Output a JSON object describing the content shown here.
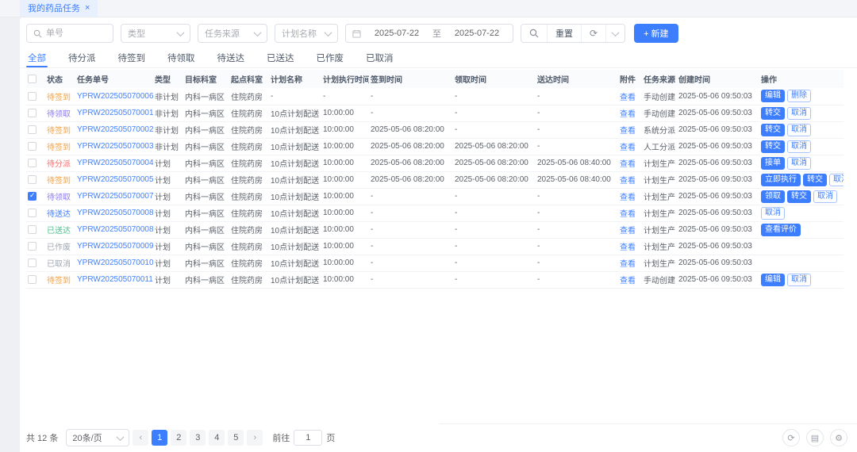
{
  "colors": {
    "primary": "#3D7EFF",
    "link": "#4080FF",
    "status": {
      "orange": "#F2A143",
      "purple": "#8A7BF0",
      "red": "#F56E6E",
      "blue": "#4080FF",
      "green": "#4FC08D",
      "gray": "#A1A7B0"
    }
  },
  "icons": {
    "close": "×",
    "refresh": "⟳",
    "grid": "▤",
    "gear": "⚙",
    "prev": "‹",
    "next": "›"
  },
  "tabbar": {
    "title": "我的药品任务"
  },
  "filters": {
    "order_placeholder": "单号",
    "type_placeholder": "类型",
    "source_placeholder": "任务来源",
    "plan_placeholder": "计划名称",
    "date_start": "2025-07-22",
    "date_to_label": "至",
    "date_end": "2025-07-22",
    "reset_label": "重置",
    "create_label": "+ 新建"
  },
  "status_tabs": [
    {
      "id": "all",
      "label": "全部",
      "active": true
    },
    {
      "id": "to-dispatch",
      "label": "待分派",
      "active": false
    },
    {
      "id": "to-signin",
      "label": "待签到",
      "active": false
    },
    {
      "id": "to-pickup",
      "label": "待领取",
      "active": false
    },
    {
      "id": "to-deliver",
      "label": "待送达",
      "active": false
    },
    {
      "id": "delivered",
      "label": "已送达",
      "active": false
    },
    {
      "id": "voided",
      "label": "已作废",
      "active": false
    },
    {
      "id": "cancelled",
      "label": "已取消",
      "active": false
    }
  ],
  "table": {
    "columns": [
      {
        "key": "status",
        "label": "状态"
      },
      {
        "key": "task-no",
        "label": "任务单号"
      },
      {
        "key": "type",
        "label": "类型"
      },
      {
        "key": "target-dept",
        "label": "目标科室"
      },
      {
        "key": "start-dept",
        "label": "起点科室"
      },
      {
        "key": "plan-name",
        "label": "计划名称"
      },
      {
        "key": "plan-exec-time",
        "label": "计划执行时间"
      },
      {
        "key": "signin-time",
        "label": "签到时间"
      },
      {
        "key": "pickup-time",
        "label": "领取时间"
      },
      {
        "key": "delivery-time",
        "label": "送达时间"
      },
      {
        "key": "attachment",
        "label": "附件"
      },
      {
        "key": "task-source",
        "label": "任务来源"
      },
      {
        "key": "created-time",
        "label": "创建时间"
      },
      {
        "key": "ops",
        "label": "操作"
      }
    ],
    "rows": [
      {
        "checked": false,
        "status": "待签到",
        "status_color": "orange",
        "task_no": "YPRW202505070006",
        "type": "非计划",
        "target_dept": "内科一病区",
        "start_dept": "住院药房",
        "plan_name": "-",
        "plan_exec_time": "-",
        "signin_time": "-",
        "pickup_time": "-",
        "delivery_time": "-",
        "attachment": "查看",
        "source": "手动创建",
        "created_time": "2025-05-06 09:50:03",
        "actions": [
          {
            "label": "编辑",
            "style": "solid"
          },
          {
            "label": "删除",
            "style": "outline"
          }
        ]
      },
      {
        "checked": false,
        "status": "待领取",
        "status_color": "purple",
        "task_no": "YPRW202505070001",
        "type": "非计划",
        "target_dept": "内科一病区",
        "start_dept": "住院药房",
        "plan_name": "10点计划配送",
        "plan_exec_time": "10:00:00",
        "signin_time": "-",
        "pickup_time": "-",
        "delivery_time": "-",
        "attachment": "查看",
        "source": "手动创建",
        "created_time": "2025-05-06 09:50:03",
        "actions": [
          {
            "label": "转交",
            "style": "solid"
          },
          {
            "label": "取消",
            "style": "outline"
          }
        ]
      },
      {
        "checked": false,
        "status": "待签到",
        "status_color": "orange",
        "task_no": "YPRW202505070002",
        "type": "非计划",
        "target_dept": "内科一病区",
        "start_dept": "住院药房",
        "plan_name": "10点计划配送",
        "plan_exec_time": "10:00:00",
        "signin_time": "2025-05-06 08:20:00",
        "pickup_time": "-",
        "delivery_time": "-",
        "attachment": "查看",
        "source": "系统分派",
        "created_time": "2025-05-06 09:50:03",
        "actions": [
          {
            "label": "转交",
            "style": "solid"
          },
          {
            "label": "取消",
            "style": "outline"
          }
        ]
      },
      {
        "checked": false,
        "status": "待签到",
        "status_color": "orange",
        "task_no": "YPRW202505070003",
        "type": "非计划",
        "target_dept": "内科一病区",
        "start_dept": "住院药房",
        "plan_name": "10点计划配送",
        "plan_exec_time": "10:00:00",
        "signin_time": "2025-05-06 08:20:00",
        "pickup_time": "2025-05-06 08:20:00",
        "delivery_time": "-",
        "attachment": "查看",
        "source": "人工分派",
        "created_time": "2025-05-06 09:50:03",
        "actions": [
          {
            "label": "转交",
            "style": "solid"
          },
          {
            "label": "取消",
            "style": "outline"
          }
        ]
      },
      {
        "checked": false,
        "status": "待分派",
        "status_color": "red",
        "task_no": "YPRW202505070004",
        "type": "计划",
        "target_dept": "内科一病区",
        "start_dept": "住院药房",
        "plan_name": "10点计划配送",
        "plan_exec_time": "10:00:00",
        "signin_time": "2025-05-06 08:20:00",
        "pickup_time": "2025-05-06 08:20:00",
        "delivery_time": "2025-05-06 08:40:00",
        "attachment": "查看",
        "source": "计划生产",
        "created_time": "2025-05-06 09:50:03",
        "actions": [
          {
            "label": "接单",
            "style": "solid"
          },
          {
            "label": "取消",
            "style": "outline"
          }
        ]
      },
      {
        "checked": false,
        "status": "待签到",
        "status_color": "orange",
        "task_no": "YPRW202505070005",
        "type": "计划",
        "target_dept": "内科一病区",
        "start_dept": "住院药房",
        "plan_name": "10点计划配送",
        "plan_exec_time": "10:00:00",
        "signin_time": "2025-05-06 08:20:00",
        "pickup_time": "2025-05-06 08:20:00",
        "delivery_time": "2025-05-06 08:40:00",
        "attachment": "查看",
        "source": "计划生产",
        "created_time": "2025-05-06 09:50:03",
        "actions": [
          {
            "label": "立即执行",
            "style": "solid"
          },
          {
            "label": "转交",
            "style": "solid"
          },
          {
            "label": "取消",
            "style": "outline"
          }
        ]
      },
      {
        "checked": true,
        "status": "待领取",
        "status_color": "purple",
        "task_no": "YPRW202505070007",
        "type": "计划",
        "target_dept": "内科一病区",
        "start_dept": "住院药房",
        "plan_name": "10点计划配送",
        "plan_exec_time": "10:00:00",
        "signin_time": "-",
        "pickup_time": "-",
        "delivery_time": "-",
        "attachment": "查看",
        "source": "计划生产",
        "created_time": "2025-05-06 09:50:03",
        "actions": [
          {
            "label": "领取",
            "style": "solid"
          },
          {
            "label": "转交",
            "style": "solid"
          },
          {
            "label": "取消",
            "style": "outline"
          }
        ]
      },
      {
        "checked": false,
        "status": "待送达",
        "status_color": "blue",
        "task_no": "YPRW202505070008",
        "type": "计划",
        "target_dept": "内科一病区",
        "start_dept": "住院药房",
        "plan_name": "10点计划配送",
        "plan_exec_time": "10:00:00",
        "signin_time": "-",
        "pickup_time": "-",
        "delivery_time": "-",
        "attachment": "查看",
        "source": "计划生产",
        "created_time": "2025-05-06 09:50:03",
        "actions": [
          {
            "label": "取消",
            "style": "outline"
          }
        ]
      },
      {
        "checked": false,
        "status": "已送达",
        "status_color": "green",
        "task_no": "YPRW202505070008",
        "type": "计划",
        "target_dept": "内科一病区",
        "start_dept": "住院药房",
        "plan_name": "10点计划配送",
        "plan_exec_time": "10:00:00",
        "signin_time": "-",
        "pickup_time": "-",
        "delivery_time": "-",
        "attachment": "查看",
        "source": "计划生产",
        "created_time": "2025-05-06 09:50:03",
        "actions": [
          {
            "label": "查看评价",
            "style": "solid"
          }
        ]
      },
      {
        "checked": false,
        "status": "已作废",
        "status_color": "gray",
        "task_no": "YPRW202505070009",
        "type": "计划",
        "target_dept": "内科一病区",
        "start_dept": "住院药房",
        "plan_name": "10点计划配送",
        "plan_exec_time": "10:00:00",
        "signin_time": "-",
        "pickup_time": "-",
        "delivery_time": "-",
        "attachment": "查看",
        "source": "计划生产",
        "created_time": "2025-05-06 09:50:03",
        "actions": []
      },
      {
        "checked": false,
        "status": "已取消",
        "status_color": "gray",
        "task_no": "YPRW202505070010",
        "type": "计划",
        "target_dept": "内科一病区",
        "start_dept": "住院药房",
        "plan_name": "10点计划配送",
        "plan_exec_time": "10:00:00",
        "signin_time": "-",
        "pickup_time": "-",
        "delivery_time": "-",
        "attachment": "查看",
        "source": "计划生产",
        "created_time": "2025-05-06 09:50:03",
        "actions": []
      },
      {
        "checked": false,
        "status": "待签到",
        "status_color": "orange",
        "task_no": "YPRW202505070011",
        "type": "计划",
        "target_dept": "内科一病区",
        "start_dept": "住院药房",
        "plan_name": "10点计划配送",
        "plan_exec_time": "10:00:00",
        "signin_time": "-",
        "pickup_time": "-",
        "delivery_time": "-",
        "attachment": "查看",
        "source": "手动创建",
        "created_time": "2025-05-06 09:50:03",
        "actions": [
          {
            "label": "编辑",
            "style": "solid"
          },
          {
            "label": "取消",
            "style": "outline"
          }
        ]
      }
    ]
  },
  "pagination": {
    "total_text": "共 12 条",
    "page_size_value": "20条/页",
    "pages": [
      "1",
      "2",
      "3",
      "4",
      "5"
    ],
    "active_page": "1",
    "goto_label": "前往",
    "goto_value": "1",
    "page_unit": "页"
  }
}
